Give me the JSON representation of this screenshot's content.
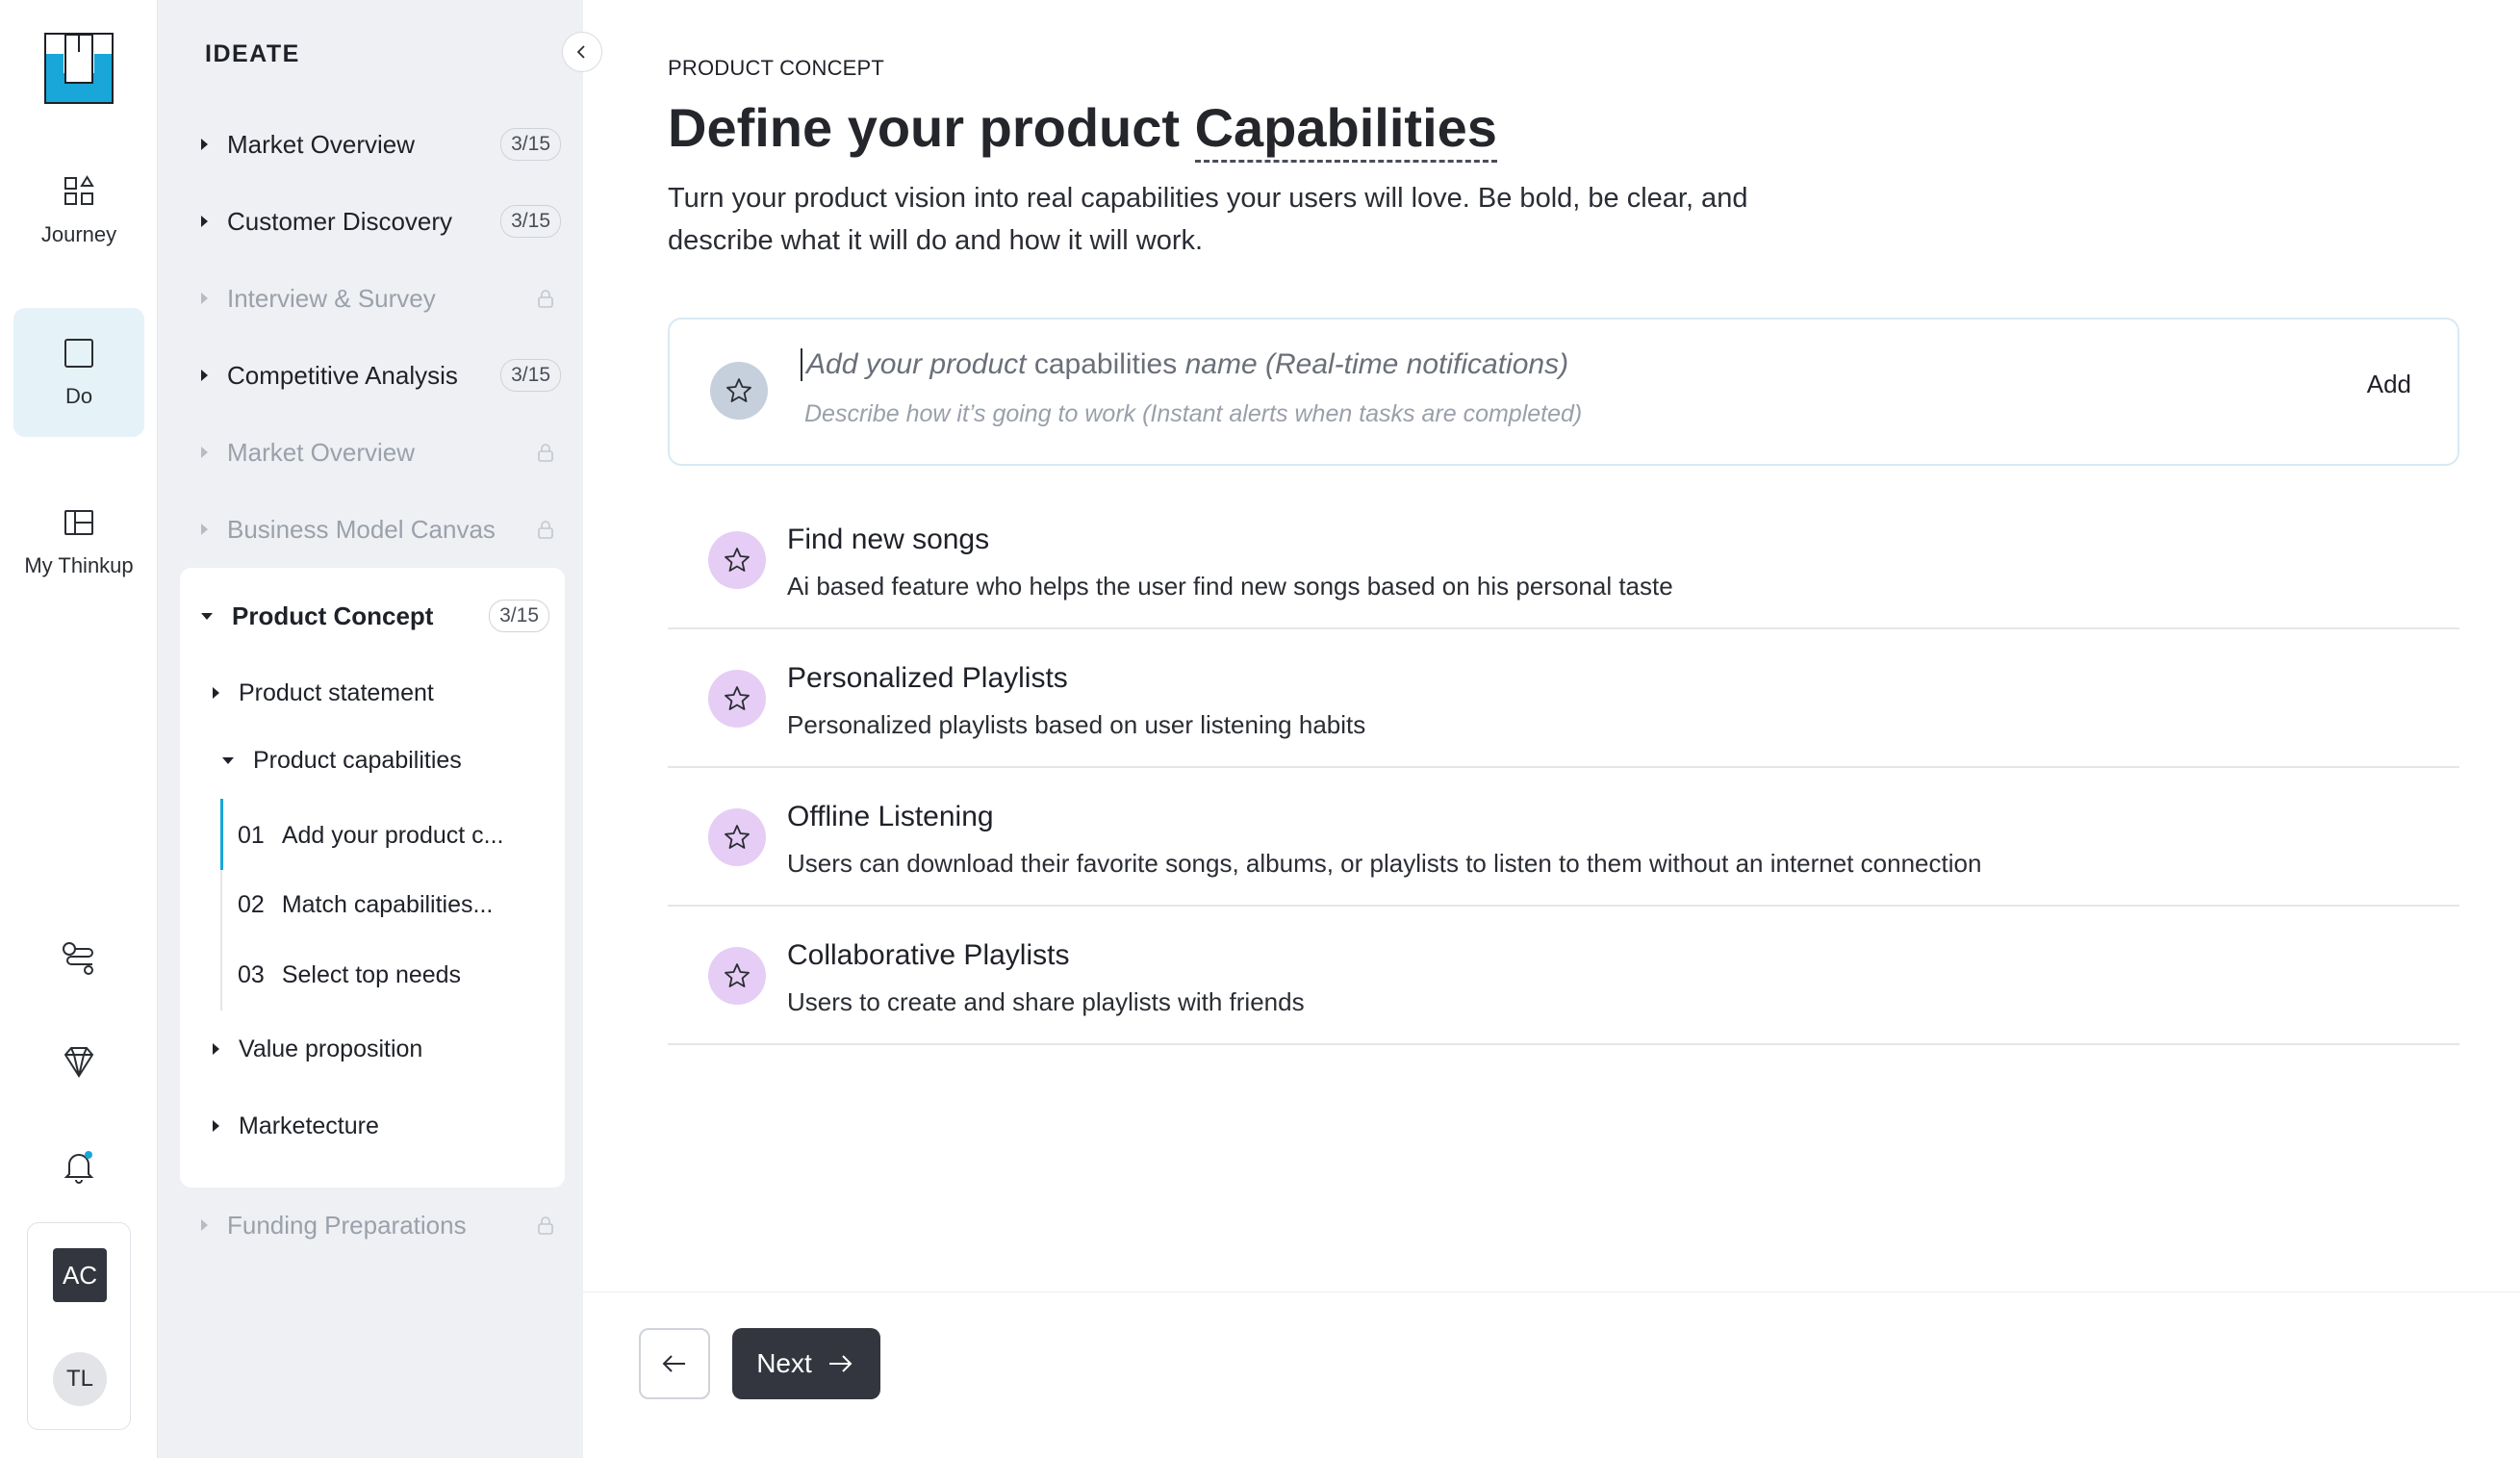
{
  "rail": {
    "items": [
      {
        "label": "Journey",
        "icon": "grid-shapes-icon"
      },
      {
        "label": "Do",
        "icon": "square-icon",
        "active": true
      },
      {
        "label": "My Thinkup",
        "icon": "layout-icon"
      }
    ],
    "avatars": {
      "workspace": "AC",
      "user": "TL"
    }
  },
  "sidebar": {
    "title": "IDEATE",
    "items": [
      {
        "label": "Market Overview",
        "badge": "3/15",
        "locked": false
      },
      {
        "label": "Customer Discovery",
        "badge": "3/15",
        "locked": false
      },
      {
        "label": "Interview & Survey",
        "badge": "",
        "locked": true
      },
      {
        "label": "Competitive Analysis",
        "badge": "3/15",
        "locked": false
      },
      {
        "label": "Market Overview",
        "badge": "",
        "locked": true
      },
      {
        "label": "Business Model Canvas",
        "badge": "",
        "locked": true
      }
    ],
    "open_section": {
      "label": "Product Concept",
      "badge": "3/15",
      "children": [
        {
          "label": "Product statement"
        },
        {
          "label": "Product capabilities"
        },
        {
          "label": "Value proposition"
        },
        {
          "label": "Marketecture"
        }
      ],
      "steps": [
        {
          "num": "01",
          "label": "Add your product c..."
        },
        {
          "num": "02",
          "label": "Match capabilities..."
        },
        {
          "num": "03",
          "label": "Select top needs"
        }
      ]
    },
    "footer_item": {
      "label": "Funding Preparations",
      "locked": true
    }
  },
  "main": {
    "eyebrow": "PRODUCT CONCEPT",
    "heading_prefix": "Define your product",
    "heading_highlight": "Capabilities",
    "intro": "Turn your product vision into real capabilities your users will love. Be bold, be clear, and describe what it will do and how it will work.",
    "add_form": {
      "name_placeholder_a": "Add your product",
      "name_placeholder_b": "capabilities",
      "name_placeholder_c": "name (Real-time notifications)",
      "desc_placeholder": "Describe how it’s going to work (Instant alerts when tasks are completed)",
      "add_label": "Add"
    },
    "capabilities": [
      {
        "title": "Find new songs",
        "desc": "Ai based feature who helps the user find new songs based on his personal taste"
      },
      {
        "title": "Personalized Playlists",
        "desc": "Personalized playlists based on user listening habits"
      },
      {
        "title": "Offline Listening",
        "desc": "Users can download their favorite songs, albums, or playlists to listen to them without an internet connection"
      },
      {
        "title": "Collaborative Playlists",
        "desc": "Users to create and share playlists with friends"
      }
    ],
    "footer": {
      "next_label": "Next"
    }
  },
  "colors": {
    "accent": "#18a7d8",
    "dark_button": "#33363e",
    "star_purple": "#e6cdf5",
    "star_grey": "#c6cfdc",
    "sidebar_bg": "#eef0f3"
  }
}
